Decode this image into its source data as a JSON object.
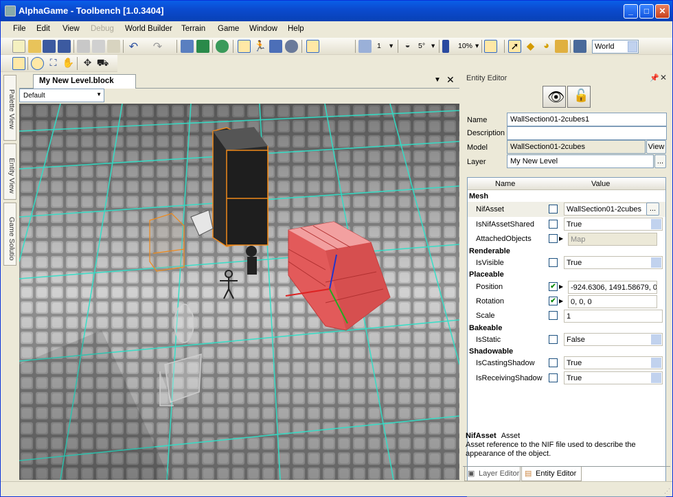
{
  "window": {
    "title": "AlphaGame - Toolbench [1.0.3404]",
    "minimize": "_",
    "maximize": "□",
    "close": "✕"
  },
  "menu": [
    {
      "label": "File",
      "enabled": true
    },
    {
      "label": "Edit",
      "enabled": true
    },
    {
      "label": "View",
      "enabled": true
    },
    {
      "label": "Debug",
      "enabled": false
    },
    {
      "label": "World Builder",
      "enabled": true
    },
    {
      "label": "Terrain",
      "enabled": true
    },
    {
      "label": "Game",
      "enabled": true
    },
    {
      "label": "Window",
      "enabled": true
    },
    {
      "label": "Help",
      "enabled": true
    }
  ],
  "toolbar": {
    "snap_count": "1",
    "angle_snap": "5°",
    "zoom": "10%",
    "coord_space": "World"
  },
  "side_tabs": [
    "Palette View",
    "Entity View",
    "Game Solutio"
  ],
  "document": {
    "tab_label": "My New Level.block",
    "layer_combo": "Default"
  },
  "entity_editor": {
    "title": "Entity Editor",
    "name_label": "Name",
    "name_value": "WallSection01-2cubes1",
    "description_label": "Description",
    "description_value": "",
    "model_label": "Model",
    "model_value": "WallSection01-2cubes",
    "model_button": "View",
    "layer_label": "Layer",
    "layer_value": "My New Level",
    "layer_button": "...",
    "grid_headers": {
      "name": "Name",
      "value": "Value"
    },
    "categories": {
      "mesh": "Mesh",
      "renderable": "Renderable",
      "placeable": "Placeable",
      "bakeable": "Bakeable",
      "shadowable": "Shadowable"
    },
    "props": {
      "nif_asset": {
        "name": "NifAsset",
        "value": "WallSection01-2cubes",
        "button": "..."
      },
      "is_nif_asset_shared": {
        "name": "IsNifAssetShared",
        "value": "True"
      },
      "attached_objects": {
        "name": "AttachedObjects",
        "value": "Map"
      },
      "is_visible": {
        "name": "IsVisible",
        "value": "True"
      },
      "position": {
        "name": "Position",
        "value": "-924.6306, 1491.58679, 0"
      },
      "rotation": {
        "name": "Rotation",
        "value": "0, 0, 0"
      },
      "scale": {
        "name": "Scale",
        "value": "1"
      },
      "is_static": {
        "name": "IsStatic",
        "value": "False"
      },
      "is_casting_shadow": {
        "name": "IsCastingShadow",
        "value": "True"
      },
      "is_receiving_shadow": {
        "name": "IsReceivingShadow",
        "value": "True"
      }
    },
    "description": {
      "title": "NifAsset",
      "type": "Asset",
      "text": "Asset reference to the NIF file used to describe the appearance of the object."
    },
    "bottom_tabs": [
      "Layer Editor",
      "Entity Editor"
    ]
  }
}
